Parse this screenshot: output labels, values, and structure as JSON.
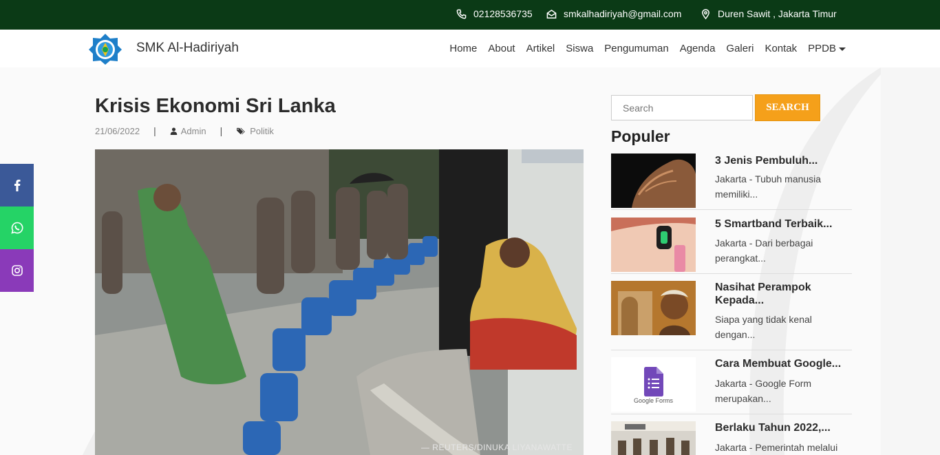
{
  "topbar": {
    "phone": "02128536735",
    "email": "smkalhadiriyah@gmail.com",
    "location": "Duren Sawit , Jakarta Timur"
  },
  "navbar": {
    "brand": "SMK Al-Hadiriyah",
    "menu": [
      "Home",
      "About",
      "Artikel",
      "Siswa",
      "Pengumuman",
      "Agenda",
      "Galeri",
      "Kontak"
    ],
    "dropdown": "PPDB"
  },
  "article": {
    "title": "Krisis Ekonomi Sri Lanka",
    "date": "21/06/2022",
    "author": "Admin",
    "category": "Politik",
    "image_credit": "— REUTERS/DINUKA LIYANAWATTE"
  },
  "social": [
    {
      "name": "facebook-icon",
      "color": "#3b5998"
    },
    {
      "name": "whatsapp-icon",
      "color": "#25d366"
    },
    {
      "name": "instagram-icon",
      "color": "#8a3ab9"
    }
  ],
  "sidebar": {
    "search_placeholder": "Search",
    "search_button": "SEARCH",
    "popular_title": "Populer",
    "popular": [
      {
        "title": "3 Jenis Pembuluh...",
        "excerpt": "Jakarta - Tubuh manusia memiliki..."
      },
      {
        "title": "5 Smartband Terbaik...",
        "excerpt": "Jakarta - Dari berbagai perangkat..."
      },
      {
        "title": "Nasihat Perampok Kepada...",
        "excerpt": "Siapa yang tidak kenal dengan..."
      },
      {
        "title": "Cara Membuat Google...",
        "excerpt": "Jakarta - Google Form merupakan...",
        "thumb_caption": "Google Forms"
      },
      {
        "title": "Berlaku Tahun 2022,...",
        "excerpt": "Jakarta - Pemerintah melalui"
      }
    ]
  },
  "colors": {
    "topbar": "#0b3a16",
    "accent": "#f5a01a",
    "facebook": "#3b5998",
    "whatsapp": "#25d366",
    "instagram": "#8a3ab9"
  }
}
